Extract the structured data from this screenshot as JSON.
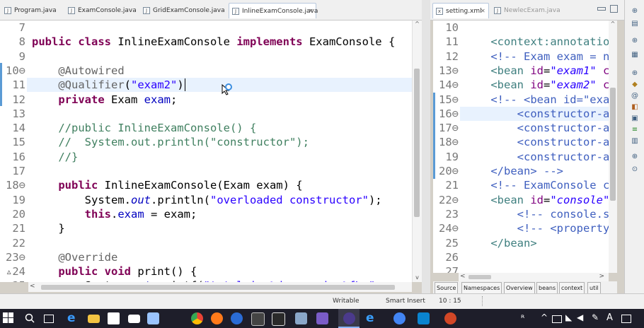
{
  "tabs_left": [
    {
      "label": "Program.java",
      "active": false
    },
    {
      "label": "ExamConsole.java",
      "active": false
    },
    {
      "label": "GridExamConsole.java",
      "active": false
    },
    {
      "label": "InlineExamConsole.java",
      "active": true,
      "close": "✕"
    }
  ],
  "tabs_right": [
    {
      "label": "setting.xml",
      "active": true,
      "close": "✕"
    },
    {
      "label": "NewlecExam.java",
      "active": false
    }
  ],
  "java_lines": [
    {
      "num": "7",
      "segs": []
    },
    {
      "num": "8",
      "segs": [
        [
          "kw",
          "public class "
        ],
        [
          "",
          "InlineExamConsole "
        ],
        [
          "kw",
          "implements "
        ],
        [
          "",
          "ExamConsole {"
        ]
      ]
    },
    {
      "num": "9",
      "segs": []
    },
    {
      "num": "10⊖",
      "segs": [
        [
          "",
          "    "
        ],
        [
          "ann",
          "@Autowired"
        ]
      ]
    },
    {
      "num": "11",
      "segs": [
        [
          "",
          "    "
        ],
        [
          "ann",
          "@Qualifier"
        ],
        [
          "",
          "("
        ],
        [
          "str",
          "\"exam2\""
        ],
        [
          "",
          ")"
        ]
      ]
    },
    {
      "num": "12",
      "segs": [
        [
          "",
          "    "
        ],
        [
          "kw",
          "private "
        ],
        [
          "",
          "Exam "
        ],
        [
          "fld",
          "exam"
        ],
        [
          "",
          ";"
        ]
      ]
    },
    {
      "num": "13",
      "segs": []
    },
    {
      "num": "14",
      "segs": [
        [
          "",
          "    "
        ],
        [
          "com",
          "//public InlineExamConsole() {"
        ]
      ]
    },
    {
      "num": "15",
      "segs": [
        [
          "",
          "    "
        ],
        [
          "com",
          "//  System.out.println(\"constructor\");"
        ]
      ]
    },
    {
      "num": "16",
      "segs": [
        [
          "",
          "    "
        ],
        [
          "com",
          "//}"
        ]
      ]
    },
    {
      "num": "17",
      "segs": []
    },
    {
      "num": "18⊖",
      "segs": [
        [
          "",
          "    "
        ],
        [
          "kw",
          "public "
        ],
        [
          "",
          "InlineExamConsole(Exam exam) {"
        ]
      ]
    },
    {
      "num": "19",
      "segs": [
        [
          "",
          "        System."
        ],
        [
          "fld ital",
          "out"
        ],
        [
          "",
          ".println("
        ],
        [
          "str",
          "\"overloaded constructor\""
        ],
        [
          "",
          ");"
        ]
      ]
    },
    {
      "num": "20",
      "segs": [
        [
          "",
          "        "
        ],
        [
          "kw",
          "this"
        ],
        [
          "",
          "."
        ],
        [
          "fld",
          "exam"
        ],
        [
          "",
          " = exam;"
        ]
      ]
    },
    {
      "num": "21",
      "segs": [
        [
          "",
          "    }"
        ]
      ]
    },
    {
      "num": "22",
      "segs": []
    },
    {
      "num": "23⊖",
      "segs": [
        [
          "",
          "    "
        ],
        [
          "ann",
          "@Override"
        ]
      ]
    },
    {
      "num": "▵24",
      "segs": [
        [
          "",
          "    "
        ],
        [
          "kw",
          "public void "
        ],
        [
          "",
          "print() {"
        ]
      ]
    },
    {
      "num": "25",
      "segs": [
        [
          "",
          "        System."
        ],
        [
          "fld ital",
          "out"
        ],
        [
          "",
          ".printf("
        ],
        [
          "str",
          "\"total is %d, avg is %f\\n\""
        ],
        [
          "",
          ", exa"
        ]
      ]
    }
  ],
  "xml_lines": [
    {
      "num": "10",
      "segs": []
    },
    {
      "num": "11",
      "segs": [
        [
          "",
          "    "
        ],
        [
          "xtag",
          "<context:annotatio"
        ]
      ]
    },
    {
      "num": "12",
      "segs": [
        [
          "",
          "    "
        ],
        [
          "xcom",
          "<!-- Exam exam = n"
        ]
      ]
    },
    {
      "num": "13⊖",
      "segs": [
        [
          "",
          "    "
        ],
        [
          "xtag",
          "<bean "
        ],
        [
          "xatt",
          "id"
        ],
        [
          "",
          "="
        ],
        [
          "xval",
          "\"exam1\""
        ],
        [
          "xatt",
          " c"
        ]
      ]
    },
    {
      "num": "14⊖",
      "segs": [
        [
          "",
          "    "
        ],
        [
          "xtag",
          "<bean "
        ],
        [
          "xatt",
          "id"
        ],
        [
          "",
          "="
        ],
        [
          "xval",
          "\"exam2\""
        ],
        [
          "xatt",
          " c"
        ]
      ]
    },
    {
      "num": "15⊖",
      "segs": [
        [
          "",
          "    "
        ],
        [
          "xcom",
          "<!-- <bean id=\"exa"
        ]
      ]
    },
    {
      "num": "16⊖",
      "segs": [
        [
          "",
          "        "
        ],
        [
          "xcom",
          "<constructor-a"
        ]
      ]
    },
    {
      "num": "17⊖",
      "segs": [
        [
          "",
          "        "
        ],
        [
          "xcom",
          "<constructor-a"
        ]
      ]
    },
    {
      "num": "18⊖",
      "segs": [
        [
          "",
          "        "
        ],
        [
          "xcom",
          "<constructor-a"
        ]
      ]
    },
    {
      "num": "19",
      "segs": [
        [
          "",
          "        "
        ],
        [
          "xcom",
          "<constructor-a"
        ]
      ]
    },
    {
      "num": "20⊖",
      "segs": [
        [
          "",
          "    "
        ],
        [
          "xcom",
          "</bean> -->"
        ]
      ]
    },
    {
      "num": "21",
      "segs": [
        [
          "",
          "    "
        ],
        [
          "xcom",
          "<!-- ExamConsole c"
        ]
      ]
    },
    {
      "num": "22⊖",
      "segs": [
        [
          "",
          "    "
        ],
        [
          "xtag",
          "<bean "
        ],
        [
          "xatt",
          "id"
        ],
        [
          "",
          "="
        ],
        [
          "xval",
          "\"console\""
        ]
      ]
    },
    {
      "num": "23",
      "segs": [
        [
          "",
          "        "
        ],
        [
          "xcom",
          "<!-- console.s"
        ]
      ]
    },
    {
      "num": "24⊖",
      "segs": [
        [
          "",
          "        "
        ],
        [
          "xcom",
          "<!-- <property"
        ]
      ]
    },
    {
      "num": "25",
      "segs": [
        [
          "",
          "    "
        ],
        [
          "xtag",
          "</bean>"
        ]
      ]
    },
    {
      "num": "26",
      "segs": []
    },
    {
      "num": "27",
      "segs": []
    }
  ],
  "bottom_tabs": [
    "Source",
    "Namespaces",
    "Overview",
    "beans",
    "context",
    "util"
  ],
  "status": {
    "writable": "Writable",
    "insert": "Smart Insert",
    "position": "10 : 15"
  },
  "taskbar": {
    "ime": "A"
  },
  "colors": {
    "keyword": "#7f0055",
    "annotation": "#646464",
    "string": "#2a00ff",
    "comment": "#3f7f5f",
    "field": "#0000c0",
    "xml_tag": "#3f7f7f",
    "xml_attr": "#7f007f",
    "xml_comment": "#3f5fbf"
  },
  "icons": [
    "java-file-icon",
    "xml-file-icon",
    "minimize-icon",
    "maximize-icon",
    "search-icon",
    "task-view-icon",
    "edge-icon",
    "file-explorer-icon",
    "store-icon",
    "mail-icon",
    "chrome-icon",
    "firefox-icon",
    "vscode-icon",
    "eclipse-icon"
  ]
}
